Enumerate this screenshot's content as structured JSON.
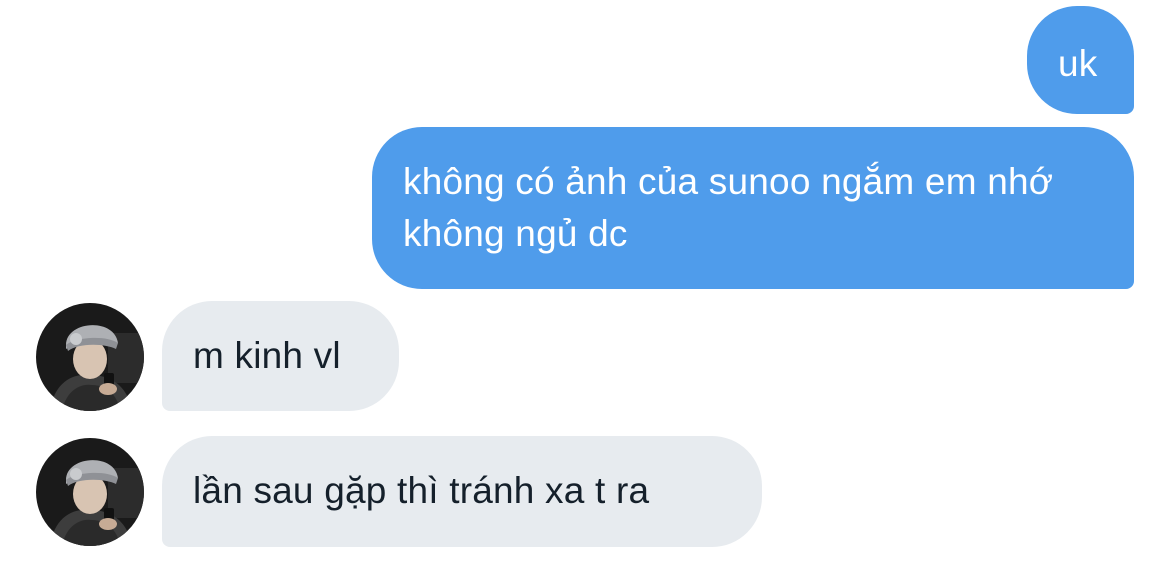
{
  "messages": [
    {
      "direction": "sent",
      "text": "uk"
    },
    {
      "direction": "sent",
      "text": "không có ảnh của sunoo ngắm em nhớ không ngủ dc"
    },
    {
      "direction": "received",
      "text": "m kinh vl"
    },
    {
      "direction": "received",
      "text": "lần sau gặp thì tránh xa t ra"
    }
  ],
  "colors": {
    "sent_bubble": "#4f9ceb",
    "received_bubble": "#e7ebef",
    "sent_text": "#ffffff",
    "received_text": "#15202b"
  },
  "icons": {
    "avatar": "contact-avatar-photo"
  }
}
